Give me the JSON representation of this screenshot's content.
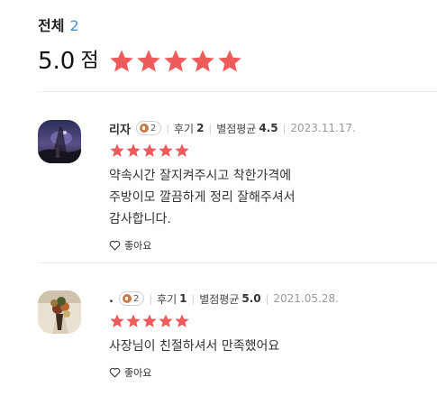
{
  "summary": {
    "title": "전체",
    "count": "2",
    "score": "5.0",
    "unit": "점",
    "rating": 5,
    "star_color": "#ee5b5b"
  },
  "reviews": [
    {
      "name": "리자",
      "badge_count": "2",
      "review_label": "후기",
      "review_count": "2",
      "avg_label": "별점평균",
      "avg_value": "4.5",
      "date": "2023.11.17.",
      "rating": 5,
      "text": "약속시간 잘지켜주시고 착한가격에\n주방이모 깔끔하게 정리 잘해주셔서\n감사합니다.",
      "like_label": "좋아요",
      "avatar_icon": "night-photo-avatar"
    },
    {
      "name": ".",
      "badge_count": "2",
      "review_label": "후기",
      "review_count": "1",
      "avg_label": "별점평균",
      "avg_value": "5.0",
      "date": "2021.05.28.",
      "rating": 5,
      "text": "사장님이 친절하셔서 만족했어요",
      "like_label": "좋아요",
      "avatar_icon": "flower-bouquet-avatar"
    }
  ],
  "icons": {
    "star": "star-icon",
    "heart": "heart-outline-icon",
    "badge": "grade-badge-icon"
  }
}
